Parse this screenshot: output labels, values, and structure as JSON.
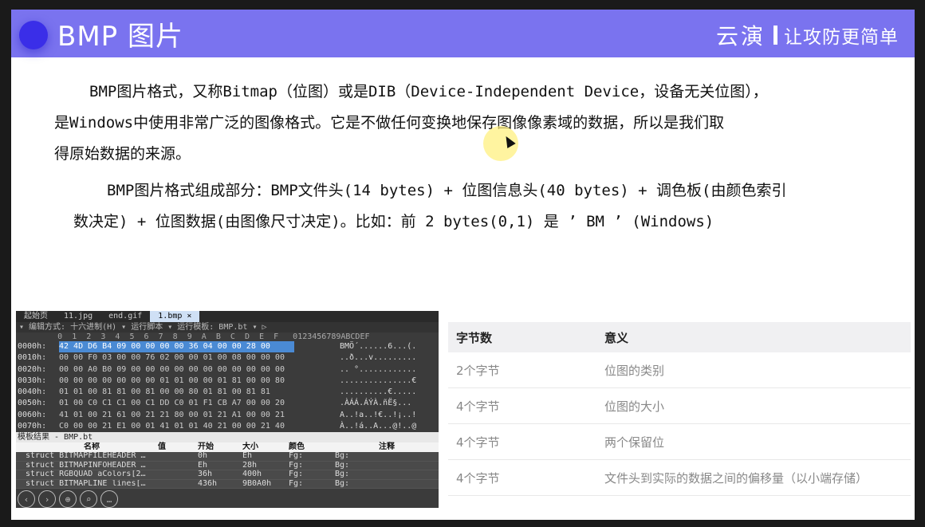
{
  "header": {
    "title": "BMP 图片",
    "brand_name": "云演",
    "brand_slogan": "让攻防更简单"
  },
  "body": {
    "p1_line1": "BMP图片格式，又称Bitmap（位图）或是DIB（Device-Independent Device，设备无关位图），",
    "p1_line2": "是Windows中使用非常广泛的图像格式。它是不做任何变换地保存图像像素域的数据，所以是我们取",
    "p1_line3": "得原始数据的来源。",
    "p2_line1": "BMP图片格式组成部分：BMP文件头(14 bytes) + 位图信息头(40 bytes) + 调色板(由颜色索引",
    "p2_line2": "数决定) + 位图数据(由图像尺寸决定)。比如：前 2 bytes(0,1) 是 ’ BM ’ (Windows)"
  },
  "hex_editor": {
    "tabs": [
      "起始页",
      "11.jpg",
      "end.gif",
      "1.bmp ×"
    ],
    "toolbar": "▾  编辑方式: 十六进制(H) ▾   运行脚本 ▾   运行模板: BMP.bt ▾ ▷",
    "col_header": "        0  1  2  3  4  5  6  7  8  9  A  B  C  D  E  F   0123456789ABCDEF",
    "rows": [
      {
        "addr": "0000h:",
        "bytes": "42 4D D6 B4 09 00 00 00 00 36 04 00 00 28 00",
        "ascii": "BMÖ´......6...(."
      },
      {
        "addr": "0010h:",
        "bytes": "00 00 F0 03 00 00 76 02 00 00 01 00 08 00 00 00",
        "ascii": "..ð...v........."
      },
      {
        "addr": "0020h:",
        "bytes": "00 00 A0 B0 09 00 00 00 00 00 00 00 00 00 00 00",
        "ascii": ".. °............"
      },
      {
        "addr": "0030h:",
        "bytes": "00 00 00 00 00 00 00 01 01 00 00 01 81 00 00 80",
        "ascii": "...............€"
      },
      {
        "addr": "0040h:",
        "bytes": "01 01 00 81 81 00 81 00 00 80 01 81 00 81 81",
        "ascii": "..........€....."
      },
      {
        "addr": "0050h:",
        "bytes": "01 00 C0 C1 C1 00 C1 DD C0 01 F1 CB A7 00 00 20",
        "ascii": ".ÀÁÁ.ÁÝÀ.ñË§..."
      },
      {
        "addr": "0060h:",
        "bytes": "41 01 00 21 61 00 21 21 80 00 01 21 A1 00 00 21",
        "ascii": "A..!a..!€..!¡..!"
      },
      {
        "addr": "0070h:",
        "bytes": "C0 00 00 21 E1 00 01 41 01 01 40 21 00 00 21 40",
        "ascii": "À..!á..A...@!..@"
      }
    ],
    "template_title": "模板结果 - BMP.bt",
    "template_headers": [
      "名称",
      "值",
      "开始",
      "大小",
      "颜色",
      "注释"
    ],
    "template_rows": [
      {
        "name": "struct BITMAPFILEHEADER …",
        "value": "",
        "start": "0h",
        "size": "Eh",
        "fg": "Fg:",
        "bg": "Bg:"
      },
      {
        "name": "struct BITMAPINFOHEADER …",
        "value": "",
        "start": "Eh",
        "size": "28h",
        "fg": "Fg:",
        "bg": "Bg:"
      },
      {
        "name": "struct RGBQUAD aColors[2…",
        "value": "",
        "start": "36h",
        "size": "400h",
        "fg": "Fg:",
        "bg": "Bg:"
      },
      {
        "name": "struct BITMAPLINE lines[…",
        "value": "",
        "start": "436h",
        "size": "9B0A0h",
        "fg": "Fg:",
        "bg": "Bg:"
      }
    ]
  },
  "table": {
    "headers": [
      "字节数",
      "意义"
    ],
    "rows": [
      [
        "2个字节",
        "位图的类别"
      ],
      [
        "4个字节",
        "位图的大小"
      ],
      [
        "4个字节",
        "两个保留位"
      ],
      [
        "4个字节",
        "文件头到实际的数据之间的偏移量（以小端存储）"
      ]
    ]
  },
  "controls": [
    "‹",
    "›",
    "⊕",
    "⌕",
    "…"
  ]
}
